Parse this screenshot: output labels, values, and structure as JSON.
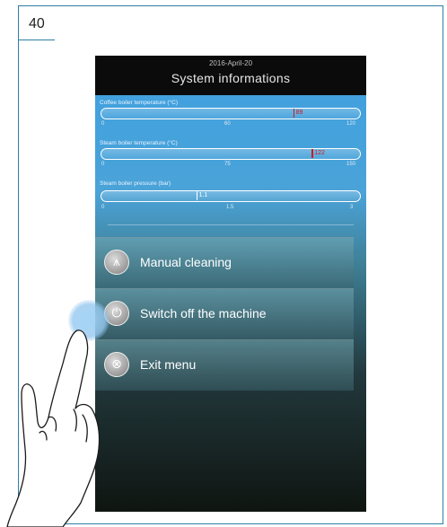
{
  "figure_number": "40",
  "screen": {
    "date": "2016-April-20",
    "title": "System informations",
    "gauges": [
      {
        "label": "Coffee boiler temperature (°C)",
        "value": 89,
        "value_text": "89",
        "min": 0,
        "max": 120,
        "mid_text": "60",
        "min_text": "0",
        "max_text": "120",
        "color": "#d01a1a"
      },
      {
        "label": "Steam boiler temperature (°C)",
        "value": 122,
        "value_text": "122",
        "min": 0,
        "max": 150,
        "mid_text": "75",
        "min_text": "0",
        "max_text": "150",
        "color": "#d01a1a"
      },
      {
        "label": "Steam boiler pressure (bar)",
        "value": 1.1,
        "value_text": "1.1",
        "min": 0,
        "max": 3,
        "mid_text": "1.5",
        "min_text": "0",
        "max_text": "3",
        "color": "#ffffff"
      }
    ],
    "menu": [
      {
        "label": "Manual cleaning",
        "icon": "shower-icon",
        "glyph": "⩚"
      },
      {
        "label": "Switch off the machine",
        "icon": "power-icon",
        "glyph": "⏻"
      },
      {
        "label": "Exit menu",
        "icon": "close-icon",
        "glyph": "⊗"
      }
    ]
  }
}
